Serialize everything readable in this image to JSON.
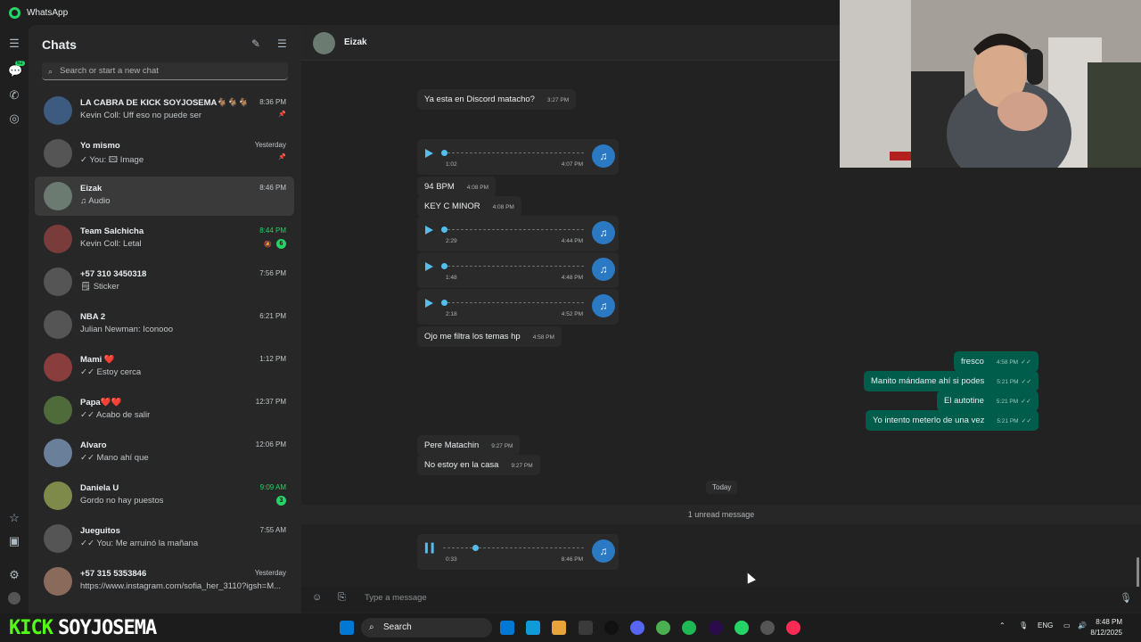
{
  "window": {
    "title": "WhatsApp"
  },
  "rail": {
    "chats_badge": "62"
  },
  "sidebar": {
    "title": "Chats",
    "search_placeholder": "Search or start a new chat",
    "chats": [
      {
        "name": "LA CABRA DE KICK SOYJOSEMA🐐🐐🐐",
        "preview": "Kevin Coll: Uff eso no puede ser",
        "time": "8:36 PM",
        "pinned": true,
        "avatar_color": "#3d5a80"
      },
      {
        "name": "Yo mismo",
        "preview": "✓ You: 🖾 Image",
        "time": "Yesterday",
        "pinned": true,
        "avatar_color": "#555"
      },
      {
        "name": "Eizak",
        "preview": "♫ Audio",
        "time": "8:46 PM",
        "active": true,
        "avatar_color": "#6b7b72"
      },
      {
        "name": "Team Salchicha",
        "preview": "Kevin Coll: Letal",
        "time": "8:44 PM",
        "time_green": true,
        "muted": true,
        "unread": "6",
        "avatar_color": "#7a3b3b"
      },
      {
        "name": "+57 310 3450318",
        "preview": "🗒 Sticker",
        "time": "7:56 PM",
        "avatar_color": "#555"
      },
      {
        "name": "NBA 2",
        "preview": "Julian Newman: Iconooo",
        "time": "6:21 PM",
        "avatar_color": "#555"
      },
      {
        "name": "Mami ❤️",
        "preview": "✓✓ Estoy cerca",
        "time": "1:12 PM",
        "avatar_color": "#8a3d3d"
      },
      {
        "name": "Papa❤️❤️",
        "preview": "✓✓ Acabo de salir",
        "time": "12:37 PM",
        "avatar_color": "#4f6b3a"
      },
      {
        "name": "Alvaro",
        "preview": "✓✓ Mano ahí que",
        "time": "12:06 PM",
        "avatar_color": "#6a7f99"
      },
      {
        "name": "Daniela U",
        "preview": "Gordo no hay puestos",
        "time": "9:09 AM",
        "time_green": true,
        "unread": "3",
        "avatar_color": "#7d8a4a"
      },
      {
        "name": "Jueguitos",
        "preview": "✓✓ You: Me arruinó la mañana",
        "time": "7:55 AM",
        "avatar_color": "#555"
      },
      {
        "name": "+57 315 5353846",
        "preview": "https://www.instagram.com/sofia_her_3110?igsh=M...",
        "time": "Yesterday",
        "avatar_color": "#8a6a5a"
      }
    ]
  },
  "conversation": {
    "contact": "Eizak",
    "messages_in": [
      {
        "text": "Ya esta en Discord matacho?",
        "time": "3:27 PM"
      },
      {
        "text": "94 BPM",
        "time": "4:08 PM"
      },
      {
        "text": "KEY C MINOR",
        "time": "4:08 PM"
      },
      {
        "text": "Ojo me filtra los temas hp",
        "time": "4:58 PM"
      },
      {
        "text": "Pere Matachin",
        "time": "9:27 PM"
      },
      {
        "text": "No estoy en la casa",
        "time": "9:27 PM"
      }
    ],
    "audios": [
      {
        "duration": "1:02",
        "time": "4:07 PM",
        "progress": 0.0
      },
      {
        "duration": "2:29",
        "time": "4:44 PM",
        "progress": 0.0
      },
      {
        "duration": "1:48",
        "time": "4:48 PM",
        "progress": 0.0
      },
      {
        "duration": "2:18",
        "time": "4:52 PM",
        "progress": 0.0
      },
      {
        "duration": "0:33",
        "time": "8:46 PM",
        "progress": 0.22,
        "playing": true
      }
    ],
    "messages_out": [
      {
        "text": "fresco",
        "time": "4:58 PM"
      },
      {
        "text": "Manito mándame ahí si podes",
        "time": "5:21 PM"
      },
      {
        "text": "El autotine",
        "time": "5:21 PM"
      },
      {
        "text": "Yo intento meterlo de una vez",
        "time": "5:21 PM"
      }
    ],
    "today_label": "Today",
    "unread_label": "1 unread message",
    "composer_placeholder": "Type a message"
  },
  "overlay": {
    "kick_label": "KICK",
    "streamer": "SOYJOSEMA"
  },
  "taskbar": {
    "search_label": "Search",
    "language": "ENG",
    "time": "8:48 PM",
    "date": "8/12/2025",
    "app_colors": [
      "#0078d4",
      "#0f9bd7",
      "#e8a43a",
      "#3a3a3a",
      "#111",
      "#5865f2",
      "#4caf50",
      "#1db954",
      "#2b0c4a",
      "#25d366",
      "#555",
      "#fe2c55"
    ]
  }
}
